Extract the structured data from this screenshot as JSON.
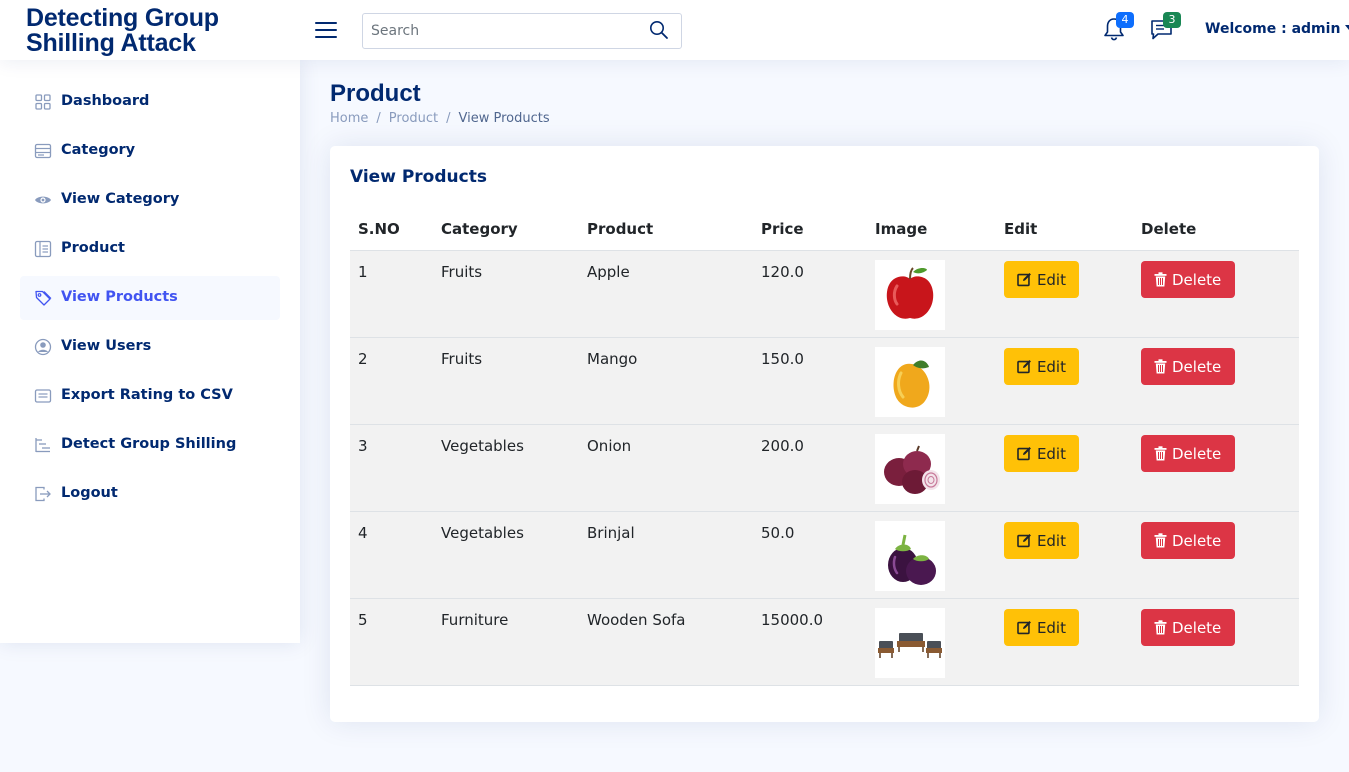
{
  "app": {
    "logo_line1": "Detecting Group",
    "logo_line2": "Shilling Attack"
  },
  "header": {
    "search_placeholder": "Search",
    "notifications_count": "4",
    "messages_count": "3",
    "welcome": "Welcome : admin"
  },
  "sidebar": {
    "items": [
      {
        "label": "Dashboard",
        "icon": "grid-icon"
      },
      {
        "label": "Category",
        "icon": "menu-icon"
      },
      {
        "label": "View Category",
        "icon": "eye-icon"
      },
      {
        "label": "Product",
        "icon": "layout-text-icon"
      },
      {
        "label": "View Products",
        "icon": "tags-icon"
      },
      {
        "label": "View Users",
        "icon": "person-circle-icon"
      },
      {
        "label": "Export Rating to CSV",
        "icon": "card-list-icon"
      },
      {
        "label": "Detect Group Shilling",
        "icon": "list-nested-icon"
      },
      {
        "label": "Logout",
        "icon": "box-arrow-right-icon"
      }
    ],
    "active_item": "View Products"
  },
  "page": {
    "title": "Product",
    "breadcrumb": [
      "Home",
      "Product",
      "View Products"
    ]
  },
  "card": {
    "title": "View Products",
    "columns": [
      "S.NO",
      "Category",
      "Product",
      "Price",
      "Image",
      "Edit",
      "Delete"
    ],
    "rows": [
      {
        "sno": "1",
        "category": "Fruits",
        "product": "Apple",
        "price": "120.0",
        "image": "apple"
      },
      {
        "sno": "2",
        "category": "Fruits",
        "product": "Mango",
        "price": "150.0",
        "image": "mango"
      },
      {
        "sno": "3",
        "category": "Vegetables",
        "product": "Onion",
        "price": "200.0",
        "image": "onion"
      },
      {
        "sno": "4",
        "category": "Vegetables",
        "product": "Brinjal",
        "price": "50.0",
        "image": "brinjal"
      },
      {
        "sno": "5",
        "category": "Furniture",
        "product": "Wooden Sofa",
        "price": "15000.0",
        "image": "sofa"
      }
    ],
    "edit_label": "Edit",
    "delete_label": "Delete"
  },
  "colors": {
    "brand": "#012970",
    "accent": "#4154f1",
    "edit": "#ffc107",
    "delete": "#dc3545",
    "notification_badge": "#0d6efd",
    "message_badge": "#198754"
  }
}
